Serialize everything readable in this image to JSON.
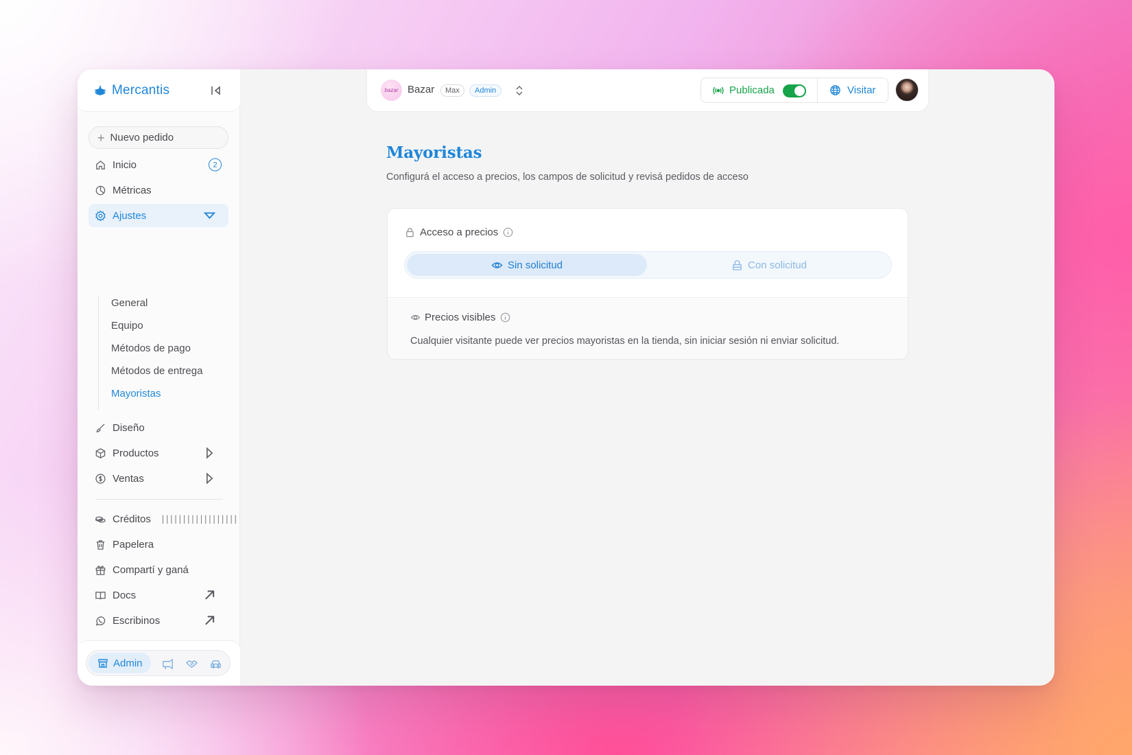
{
  "brand": {
    "name": "Mercantis"
  },
  "sidebar": {
    "new_order": "Nuevo pedido",
    "items": [
      {
        "label": "Inicio",
        "badge": "2"
      },
      {
        "label": "Métricas"
      },
      {
        "label": "Ajustes"
      },
      {
        "label": "Diseño"
      },
      {
        "label": "Productos"
      },
      {
        "label": "Ventas"
      },
      {
        "label": "Créditos",
        "meter": "||||||||||||||||||"
      },
      {
        "label": "Papelera"
      },
      {
        "label": "Compartí y ganá"
      },
      {
        "label": "Docs"
      },
      {
        "label": "Escribinos"
      }
    ],
    "settings_sub": [
      "General",
      "Equipo",
      "Métodos de pago",
      "Métodos de entrega",
      "Mayoristas"
    ],
    "mode": {
      "active_label": "Admin"
    }
  },
  "topbar": {
    "store_logo_text": "bazar",
    "store_name": "Bazar",
    "plan": "Max",
    "role": "Admin",
    "publish_label": "Publicada",
    "published": true,
    "visit_label": "Visitar"
  },
  "page": {
    "title": "Mayoristas",
    "subtitle": "Configurá el acceso a precios, los campos de solicitud y revisá pedidos de acceso",
    "access": {
      "label": "Acceso a precios",
      "options": [
        "Sin solicitud",
        "Con solicitud"
      ],
      "selected": "Sin solicitud"
    },
    "visibility": {
      "label": "Precios visibles",
      "description": "Cualquier visitante puede ver precios mayoristas en la tienda, sin iniciar sesión ni enviar solicitud."
    }
  },
  "colors": {
    "accent": "#1f86d8",
    "success": "#16a34a"
  }
}
